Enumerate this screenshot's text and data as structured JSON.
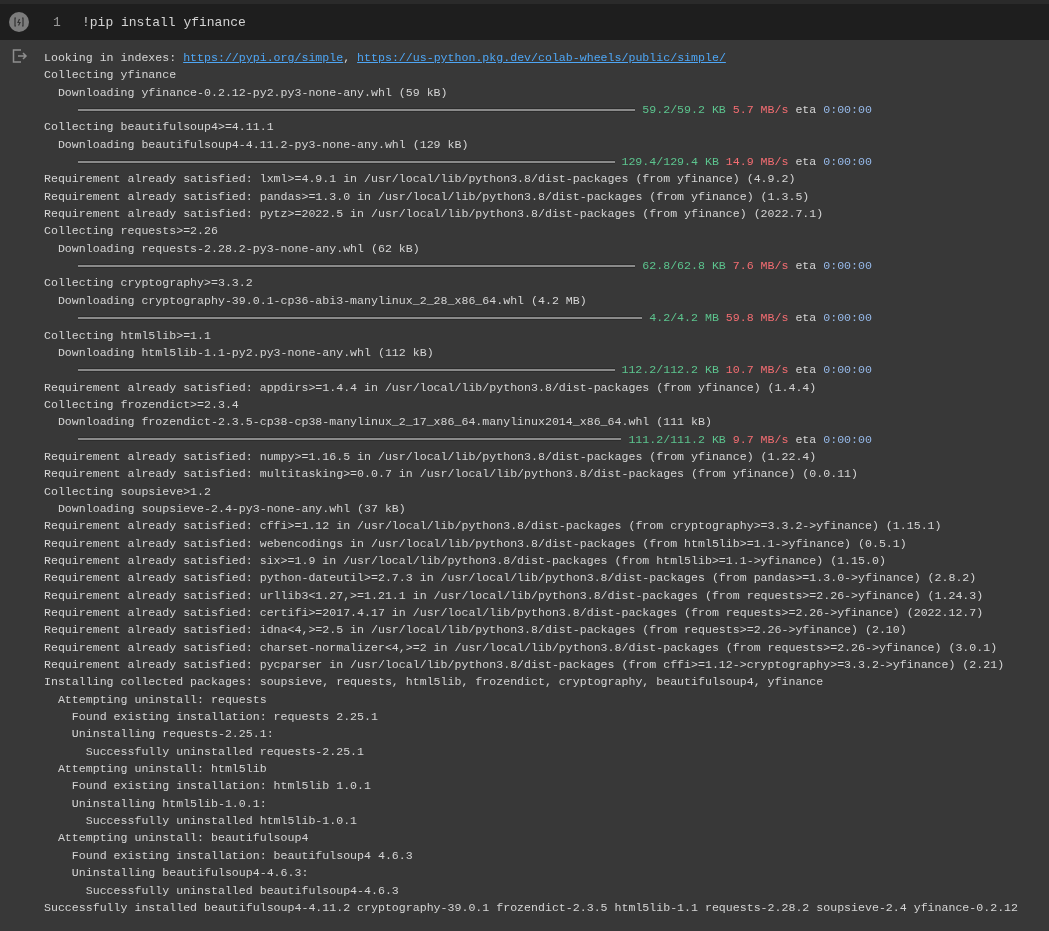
{
  "cell": {
    "line_number": "1",
    "code": "!pip install yfinance"
  },
  "output": [
    {
      "kind": "links",
      "parts": [
        {
          "text": "Looking in indexes: ",
          "link": false
        },
        {
          "text": "https://pypi.org/simple",
          "link": true
        },
        {
          "text": ", ",
          "link": false
        },
        {
          "text": "https://us-python.pkg.dev/colab-wheels/public/simple/",
          "link": true
        }
      ]
    },
    {
      "kind": "text",
      "text": "Collecting yfinance"
    },
    {
      "kind": "text",
      "text": "  Downloading yfinance-0.2.12-py2.py3-none-any.whl (59 kB)"
    },
    {
      "kind": "progress",
      "level": 1,
      "done": "59.2/59.2 KB",
      "speed": "5.7 MB/s",
      "eta_label": "eta",
      "eta": "0:00:00"
    },
    {
      "kind": "text",
      "text": "Collecting beautifulsoup4>=4.11.1"
    },
    {
      "kind": "text",
      "text": "  Downloading beautifulsoup4-4.11.2-py3-none-any.whl (129 kB)"
    },
    {
      "kind": "progress",
      "level": 1,
      "done": "129.4/129.4 KB",
      "speed": "14.9 MB/s",
      "eta_label": "eta",
      "eta": "0:00:00"
    },
    {
      "kind": "text",
      "text": "Requirement already satisfied: lxml>=4.9.1 in /usr/local/lib/python3.8/dist-packages (from yfinance) (4.9.2)"
    },
    {
      "kind": "text",
      "text": "Requirement already satisfied: pandas>=1.3.0 in /usr/local/lib/python3.8/dist-packages (from yfinance) (1.3.5)"
    },
    {
      "kind": "text",
      "text": "Requirement already satisfied: pytz>=2022.5 in /usr/local/lib/python3.8/dist-packages (from yfinance) (2022.7.1)"
    },
    {
      "kind": "text",
      "text": "Collecting requests>=2.26"
    },
    {
      "kind": "text",
      "text": "  Downloading requests-2.28.2-py3-none-any.whl (62 kB)"
    },
    {
      "kind": "progress",
      "level": 1,
      "done": "62.8/62.8 KB",
      "speed": "7.6 MB/s",
      "eta_label": "eta",
      "eta": "0:00:00"
    },
    {
      "kind": "text",
      "text": "Collecting cryptography>=3.3.2"
    },
    {
      "kind": "text",
      "text": "  Downloading cryptography-39.0.1-cp36-abi3-manylinux_2_28_x86_64.whl (4.2 MB)"
    },
    {
      "kind": "progress",
      "level": 1,
      "done": "4.2/4.2 MB",
      "speed": "59.8 MB/s",
      "eta_label": "eta",
      "eta": "0:00:00"
    },
    {
      "kind": "text",
      "text": "Collecting html5lib>=1.1"
    },
    {
      "kind": "text",
      "text": "  Downloading html5lib-1.1-py2.py3-none-any.whl (112 kB)"
    },
    {
      "kind": "progress",
      "level": 1,
      "done": "112.2/112.2 KB",
      "speed": "10.7 MB/s",
      "eta_label": "eta",
      "eta": "0:00:00"
    },
    {
      "kind": "text",
      "text": "Requirement already satisfied: appdirs>=1.4.4 in /usr/local/lib/python3.8/dist-packages (from yfinance) (1.4.4)"
    },
    {
      "kind": "text",
      "text": "Collecting frozendict>=2.3.4"
    },
    {
      "kind": "text",
      "text": "  Downloading frozendict-2.3.5-cp38-cp38-manylinux_2_17_x86_64.manylinux2014_x86_64.whl (111 kB)"
    },
    {
      "kind": "progress",
      "level": 1,
      "done": "111.2/111.2 KB",
      "speed": "9.7 MB/s",
      "eta_label": "eta",
      "eta": "0:00:00"
    },
    {
      "kind": "text",
      "text": "Requirement already satisfied: numpy>=1.16.5 in /usr/local/lib/python3.8/dist-packages (from yfinance) (1.22.4)"
    },
    {
      "kind": "text",
      "text": "Requirement already satisfied: multitasking>=0.0.7 in /usr/local/lib/python3.8/dist-packages (from yfinance) (0.0.11)"
    },
    {
      "kind": "text",
      "text": "Collecting soupsieve>1.2"
    },
    {
      "kind": "text",
      "text": "  Downloading soupsieve-2.4-py3-none-any.whl (37 kB)"
    },
    {
      "kind": "text",
      "text": "Requirement already satisfied: cffi>=1.12 in /usr/local/lib/python3.8/dist-packages (from cryptography>=3.3.2->yfinance) (1.15.1)"
    },
    {
      "kind": "text",
      "text": "Requirement already satisfied: webencodings in /usr/local/lib/python3.8/dist-packages (from html5lib>=1.1->yfinance) (0.5.1)"
    },
    {
      "kind": "text",
      "text": "Requirement already satisfied: six>=1.9 in /usr/local/lib/python3.8/dist-packages (from html5lib>=1.1->yfinance) (1.15.0)"
    },
    {
      "kind": "text",
      "text": "Requirement already satisfied: python-dateutil>=2.7.3 in /usr/local/lib/python3.8/dist-packages (from pandas>=1.3.0->yfinance) (2.8.2)"
    },
    {
      "kind": "text",
      "text": "Requirement already satisfied: urllib3<1.27,>=1.21.1 in /usr/local/lib/python3.8/dist-packages (from requests>=2.26->yfinance) (1.24.3)"
    },
    {
      "kind": "text",
      "text": "Requirement already satisfied: certifi>=2017.4.17 in /usr/local/lib/python3.8/dist-packages (from requests>=2.26->yfinance) (2022.12.7)"
    },
    {
      "kind": "text",
      "text": "Requirement already satisfied: idna<4,>=2.5 in /usr/local/lib/python3.8/dist-packages (from requests>=2.26->yfinance) (2.10)"
    },
    {
      "kind": "text",
      "text": "Requirement already satisfied: charset-normalizer<4,>=2 in /usr/local/lib/python3.8/dist-packages (from requests>=2.26->yfinance) (3.0.1)"
    },
    {
      "kind": "text",
      "text": "Requirement already satisfied: pycparser in /usr/local/lib/python3.8/dist-packages (from cffi>=1.12->cryptography>=3.3.2->yfinance) (2.21)"
    },
    {
      "kind": "text",
      "text": "Installing collected packages: soupsieve, requests, html5lib, frozendict, cryptography, beautifulsoup4, yfinance"
    },
    {
      "kind": "text",
      "text": "  Attempting uninstall: requests"
    },
    {
      "kind": "text",
      "text": "    Found existing installation: requests 2.25.1"
    },
    {
      "kind": "text",
      "text": "    Uninstalling requests-2.25.1:"
    },
    {
      "kind": "text",
      "text": "      Successfully uninstalled requests-2.25.1"
    },
    {
      "kind": "text",
      "text": "  Attempting uninstall: html5lib"
    },
    {
      "kind": "text",
      "text": "    Found existing installation: html5lib 1.0.1"
    },
    {
      "kind": "text",
      "text": "    Uninstalling html5lib-1.0.1:"
    },
    {
      "kind": "text",
      "text": "      Successfully uninstalled html5lib-1.0.1"
    },
    {
      "kind": "text",
      "text": "  Attempting uninstall: beautifulsoup4"
    },
    {
      "kind": "text",
      "text": "    Found existing installation: beautifulsoup4 4.6.3"
    },
    {
      "kind": "text",
      "text": "    Uninstalling beautifulsoup4-4.6.3:"
    },
    {
      "kind": "text",
      "text": "      Successfully uninstalled beautifulsoup4-4.6.3"
    },
    {
      "kind": "text",
      "text": "Successfully installed beautifulsoup4-4.11.2 cryptography-39.0.1 frozendict-2.3.5 html5lib-1.1 requests-2.28.2 soupsieve-2.4 yfinance-0.2.12"
    }
  ]
}
